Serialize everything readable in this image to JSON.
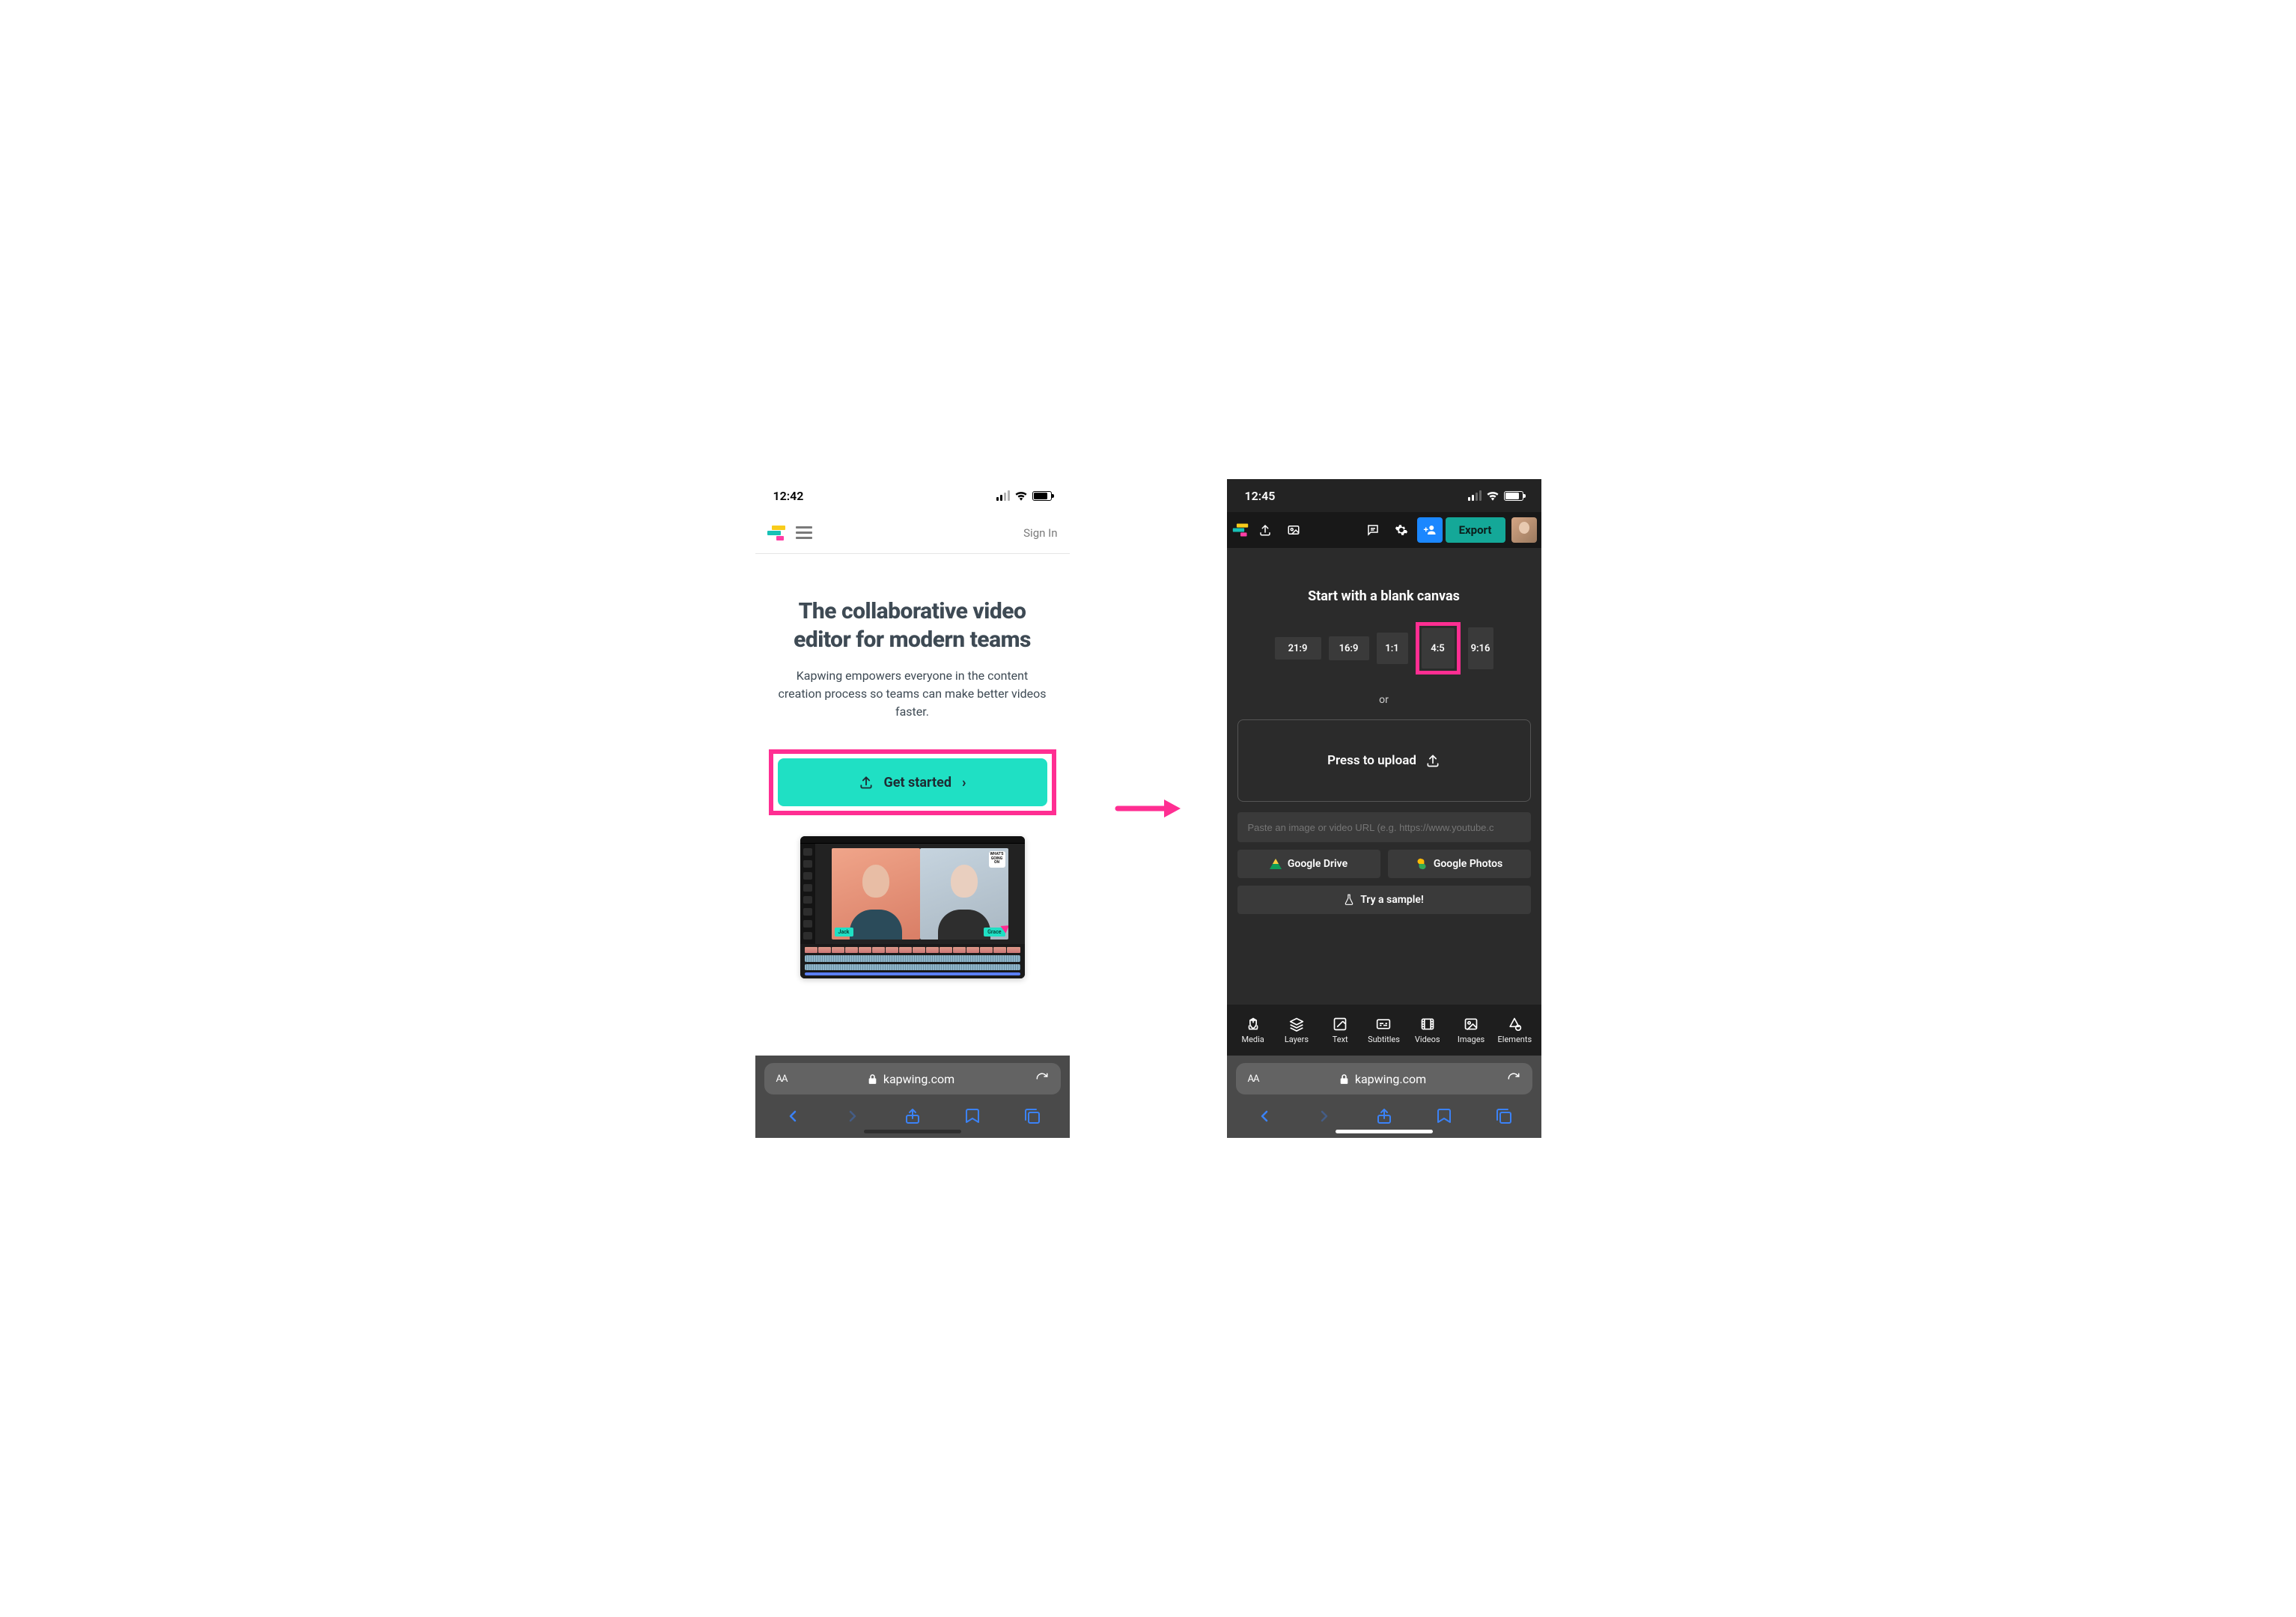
{
  "phoneA": {
    "status_time": "12:42",
    "signin": "Sign In",
    "heading": "The collaborative video editor for modern teams",
    "subheading": "Kapwing empowers everyone in the content creation process so teams can make better videos faster.",
    "cta_label": "Get started",
    "preview": {
      "tag_left": "Jack",
      "tag_right": "Grace",
      "corner": "WHAT'S GOING ON"
    },
    "browser": {
      "aa": "AA",
      "domain": "kapwing.com"
    }
  },
  "phoneB": {
    "status_time": "12:45",
    "export_label": "Export",
    "canvas_title": "Start with a blank canvas",
    "ratios": {
      "r219": "21:9",
      "r169": "16:9",
      "r11": "1:1",
      "r45": "4:5",
      "r916": "9:16"
    },
    "or_text": "or",
    "upload_label": "Press to upload",
    "url_placeholder": "Paste an image or video URL (e.g. https://www.youtube.c",
    "gdrive_label": "Google Drive",
    "gphotos_label": "Google Photos",
    "sample_label": "Try a sample!",
    "tools": {
      "media": "Media",
      "layers": "Layers",
      "text": "Text",
      "subtitles": "Subtitles",
      "videos": "Videos",
      "images": "Images",
      "elements": "Elements"
    },
    "browser": {
      "aa": "AA",
      "domain": "kapwing.com"
    }
  }
}
